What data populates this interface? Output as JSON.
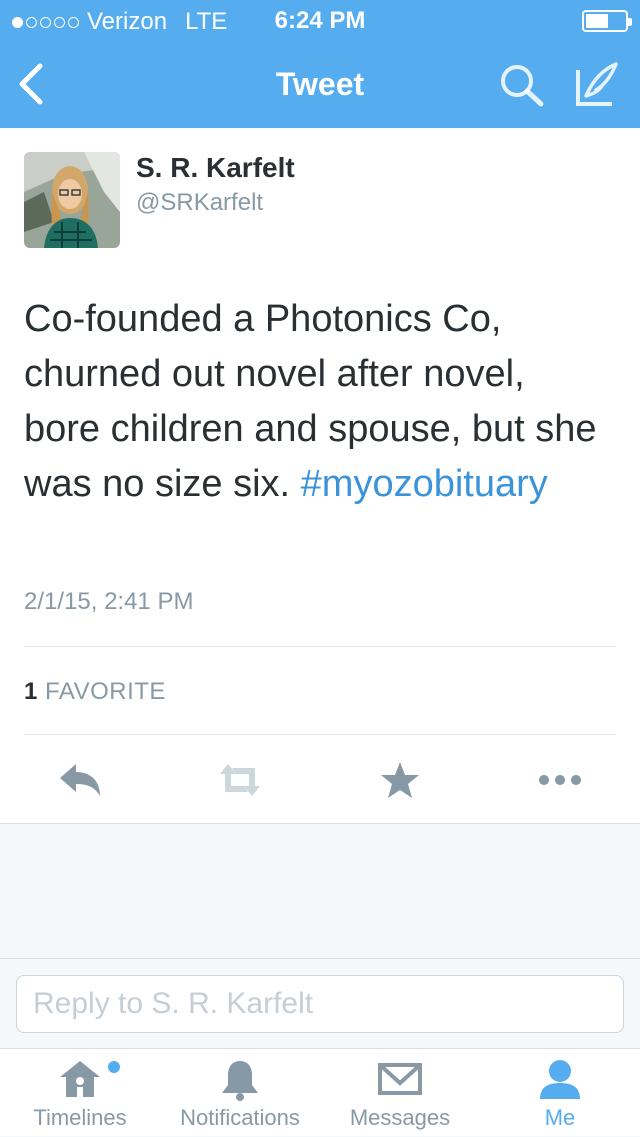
{
  "status_bar": {
    "carrier": "Verizon",
    "network": "LTE",
    "time": "6:24 PM",
    "signal_bars_filled": 1,
    "signal_bars_total": 5
  },
  "nav": {
    "title": "Tweet",
    "back_icon": "chevron-left-icon",
    "search_icon": "search-icon",
    "compose_icon": "compose-icon"
  },
  "tweet": {
    "author_name": "S. R. Karfelt",
    "author_handle": "@SRKarfelt",
    "text": "Co-founded a Photonics Co, churned out novel after novel, bore children and spouse, but she was no size six. ",
    "hashtag": "#myozobituary",
    "timestamp": "2/1/15, 2:41 PM",
    "favorite_count": "1",
    "favorite_label": "FAVORITE"
  },
  "actions": [
    "reply-icon",
    "retweet-icon",
    "favorite-icon",
    "more-icon"
  ],
  "reply": {
    "placeholder": "Reply to S. R. Karfelt"
  },
  "tabs": [
    {
      "label": "Timelines",
      "icon": "home-icon",
      "active": false,
      "has_badge": true
    },
    {
      "label": "Notifications",
      "icon": "bell-icon",
      "active": false,
      "has_badge": false
    },
    {
      "label": "Messages",
      "icon": "envelope-icon",
      "active": false,
      "has_badge": false
    },
    {
      "label": "Me",
      "icon": "person-icon",
      "active": true,
      "has_badge": false
    }
  ],
  "colors": {
    "brand": "#55acee",
    "link": "#3b94d9",
    "text": "#292f33",
    "muted": "#8899a6"
  }
}
